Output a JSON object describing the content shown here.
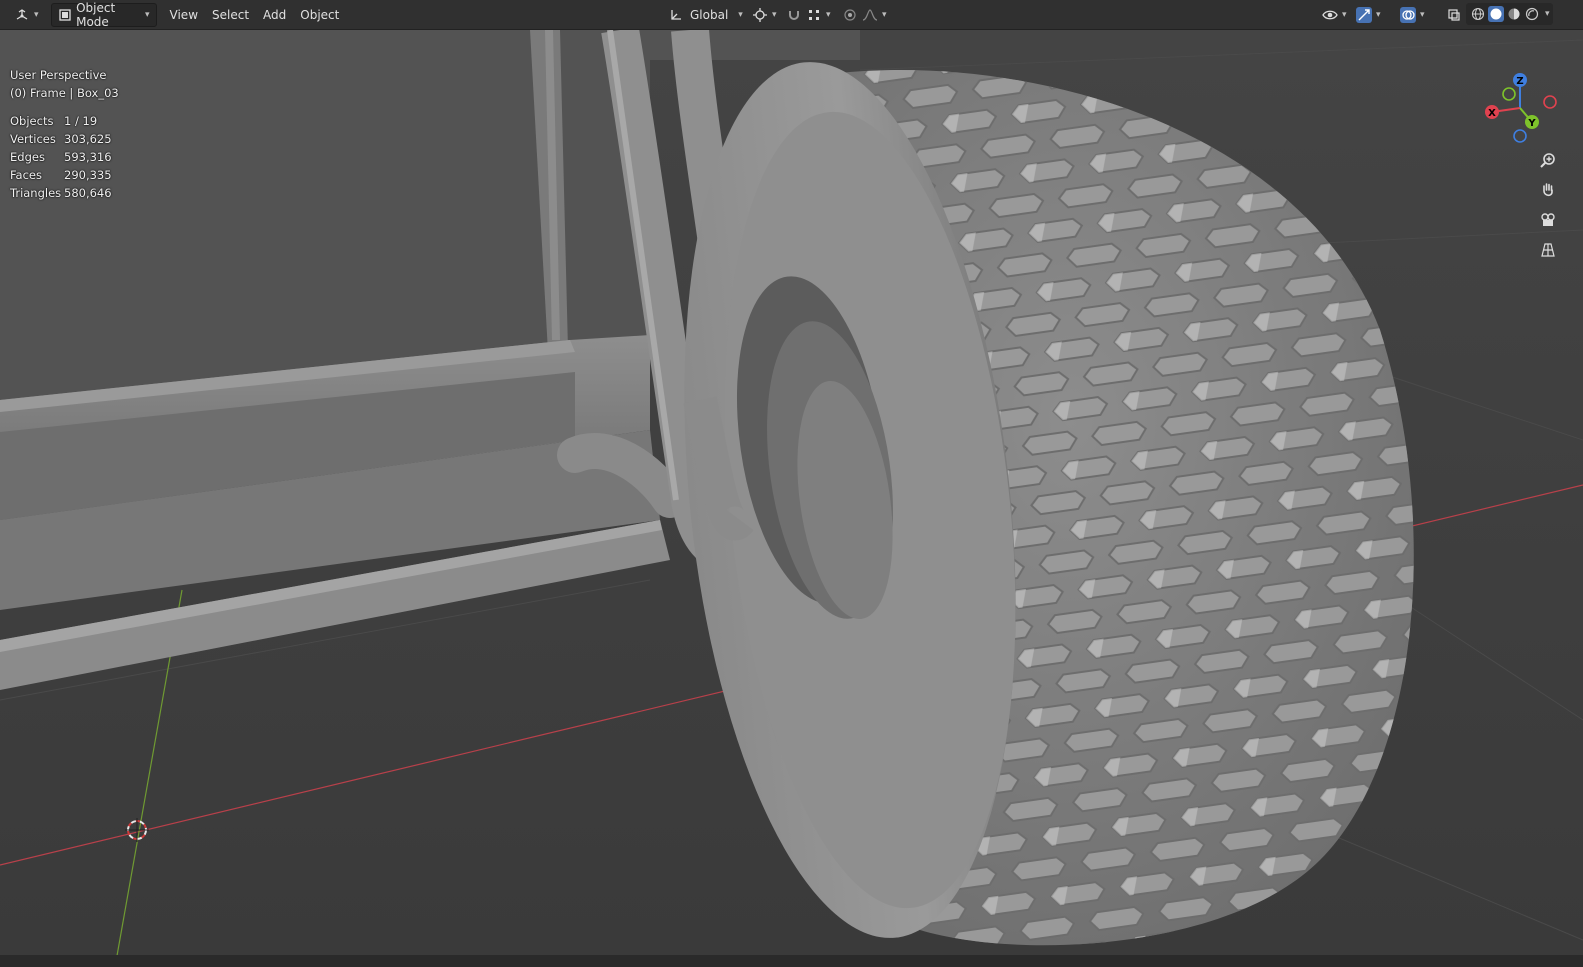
{
  "header": {
    "editor_type_icon": "3d-viewport-icon",
    "mode": {
      "label": "Object Mode",
      "icon": "object-mode-icon"
    },
    "menus": [
      "View",
      "Select",
      "Add",
      "Object"
    ],
    "transform_orientation": {
      "label": "Global",
      "icon": "transform-orientation-icon"
    },
    "right_icons": [
      "visibility-icon",
      "gizmo-icon",
      "overlay-icon",
      "xray-icon",
      "wireframe-shading-icon",
      "solid-shading-icon",
      "material-shading-icon",
      "rendered-shading-icon"
    ]
  },
  "overlay": {
    "perspective": "User Perspective",
    "frame_object": "(0) Frame | Box_03",
    "stats": [
      {
        "label": "Objects",
        "value": "1 / 19"
      },
      {
        "label": "Vertices",
        "value": "303,625"
      },
      {
        "label": "Edges",
        "value": "593,316"
      },
      {
        "label": "Faces",
        "value": "290,335"
      },
      {
        "label": "Triangles",
        "value": "580,646"
      }
    ]
  },
  "gizmo": {
    "x_label": "X",
    "y_label": "Y",
    "z_label": "Z"
  },
  "nav_buttons": [
    "zoom-icon",
    "pan-hand-icon",
    "camera-icon",
    "perspective-grid-icon"
  ],
  "colors": {
    "header_bg": "#303030",
    "viewport_bg": "#3d3d3d",
    "x_axis": "#e0424f",
    "y_axis": "#7ec32b",
    "z_axis": "#3f7fe0",
    "accent": "#4772b3"
  }
}
